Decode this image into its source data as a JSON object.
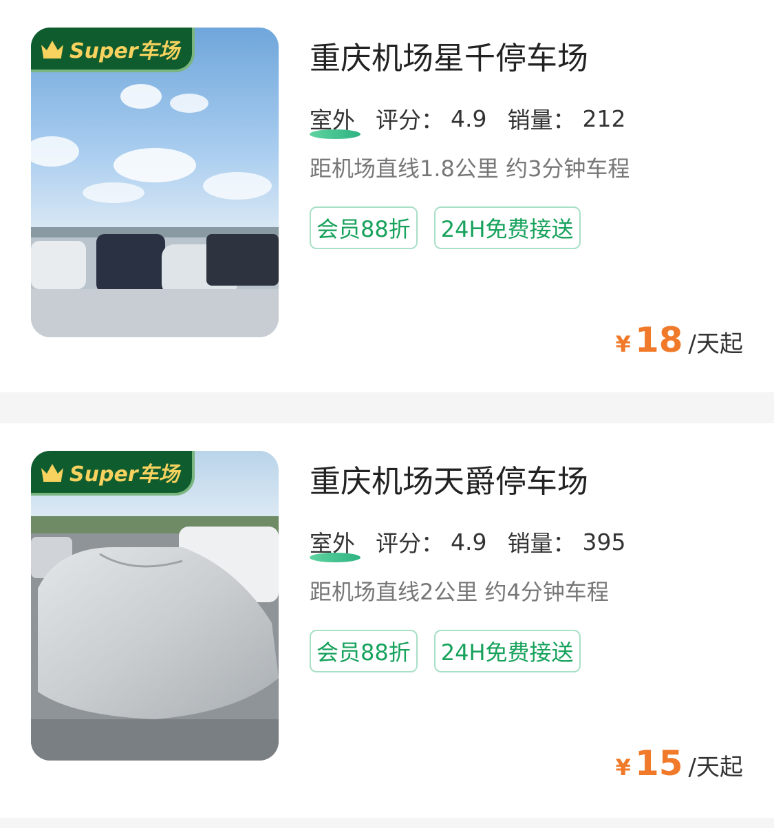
{
  "listings": [
    {
      "badge": "Super车场",
      "name": "重庆机场星千停车场",
      "type": "室外",
      "rating_label": "评分：",
      "rating_value": "4.9",
      "sales_label": "销量：",
      "sales_value": "212",
      "distance": "距机场直线1.8公里 约3分钟车程",
      "tags": [
        "会员88折",
        "24H免费接送"
      ],
      "currency": "¥",
      "price": "18",
      "price_unit": "/天起"
    },
    {
      "badge": "Super车场",
      "name": "重庆机场天爵停车场",
      "type": "室外",
      "rating_label": "评分：",
      "rating_value": "4.9",
      "sales_label": "销量：",
      "sales_value": "395",
      "distance": "距机场直线2公里 约4分钟车程",
      "tags": [
        "会员88折",
        "24H免费接送"
      ],
      "currency": "¥",
      "price": "15",
      "price_unit": "/天起"
    }
  ],
  "colors": {
    "badge_bg": "#0f5c2e",
    "badge_text": "#f7d25f",
    "tag_text": "#17a25c",
    "tag_border": "#a8dfc7",
    "price": "#f07a2a",
    "separator": "#f5f5f5"
  },
  "icons": {
    "badge": "crown-icon"
  }
}
